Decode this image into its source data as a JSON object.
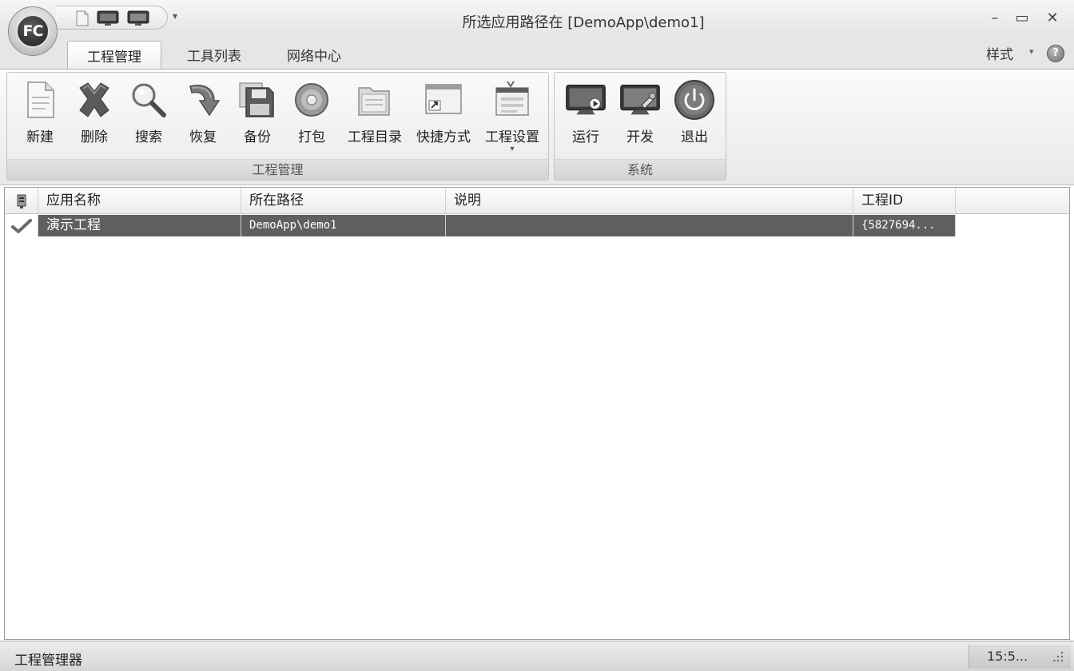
{
  "window": {
    "title": "所选应用路径在 [DemoApp\\demo1]"
  },
  "app_button": {
    "logo_text": "FC"
  },
  "title_controls": {
    "minimize": "–",
    "maximize": "▭",
    "close": "✕",
    "qat_more": "▾"
  },
  "tabs": [
    {
      "label": "工程管理",
      "active": true
    },
    {
      "label": "工具列表",
      "active": false
    },
    {
      "label": "网络中心",
      "active": false
    }
  ],
  "style_menu": {
    "label": "样式",
    "caret": "▾",
    "help": "?"
  },
  "ribbon": {
    "groups": [
      {
        "label": "工程管理",
        "buttons": [
          {
            "label": "新建",
            "icon": "new-document-icon"
          },
          {
            "label": "删除",
            "icon": "delete-x-icon"
          },
          {
            "label": "搜索",
            "icon": "magnifier-icon"
          },
          {
            "label": "恢复",
            "icon": "restore-arrow-icon"
          },
          {
            "label": "备份",
            "icon": "floppy-disk-icon"
          },
          {
            "label": "打包",
            "icon": "disc-package-icon"
          },
          {
            "label": "工程目录",
            "icon": "folder-directory-icon"
          },
          {
            "label": "快捷方式",
            "icon": "shortcut-window-icon"
          },
          {
            "label": "工程设置",
            "icon": "settings-window-icon",
            "dropdown": "▾"
          }
        ]
      },
      {
        "label": "系统",
        "buttons": [
          {
            "label": "运行",
            "icon": "run-monitor-icon"
          },
          {
            "label": "开发",
            "icon": "develop-monitor-icon"
          },
          {
            "label": "退出",
            "icon": "power-icon"
          }
        ]
      }
    ]
  },
  "table": {
    "columns": [
      "应用名称",
      "所在路径",
      "说明",
      "工程ID"
    ],
    "rows": [
      {
        "name": "演示工程",
        "path": "DemoApp\\demo1",
        "description": "",
        "id": "{5827694..."
      }
    ]
  },
  "statusbar": {
    "text": "工程管理器",
    "time": "15:5..."
  }
}
